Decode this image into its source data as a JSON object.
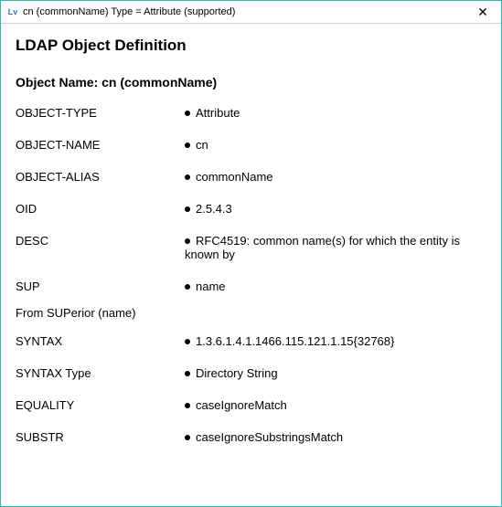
{
  "titlebar": {
    "icon_text": "Lv",
    "title": "cn (commonName) Type = Attribute (supported)",
    "close": "✕"
  },
  "content": {
    "main_title": "LDAP Object Definition",
    "sub_title": "Object Name: cn (commonName)",
    "rows": [
      {
        "label": "OBJECT-TYPE",
        "value": "Attribute"
      },
      {
        "label": "OBJECT-NAME",
        "value": "cn"
      },
      {
        "label": "OBJECT-ALIAS",
        "value": "commonName"
      },
      {
        "label": "OID",
        "value": "2.5.4.3"
      },
      {
        "label": "DESC",
        "value": "RFC4519: common name(s) for which the entity is known by"
      },
      {
        "label": "SUP",
        "value": "name"
      }
    ],
    "superior_note": "From SUPerior (name)",
    "rows2": [
      {
        "label": "SYNTAX",
        "value": "1.3.6.1.4.1.1466.115.121.1.15{32768}"
      },
      {
        "label": "SYNTAX Type",
        "value": "Directory String"
      },
      {
        "label": "EQUALITY",
        "value": "caseIgnoreMatch"
      },
      {
        "label": "SUBSTR",
        "value": "caseIgnoreSubstringsMatch"
      }
    ]
  }
}
